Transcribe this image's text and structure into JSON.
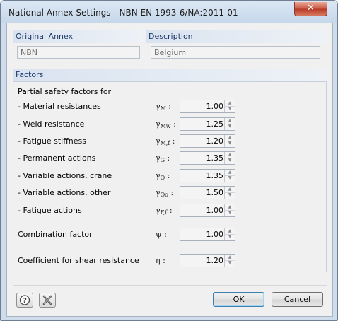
{
  "window": {
    "title": "National Annex Settings - NBN EN 1993-6/NA:2011-01",
    "close_glyph": "✕"
  },
  "original_annex": {
    "title": "Original Annex",
    "value": "NBN"
  },
  "description": {
    "title": "Description",
    "value": "Belgium"
  },
  "factors": {
    "title": "Factors",
    "partial_heading": "Partial safety factors for",
    "rows": [
      {
        "label": "- Material resistances",
        "sym": "γ",
        "sub": "M",
        "value": "1.00"
      },
      {
        "label": "- Weld resistance",
        "sym": "γ",
        "sub": "Mw",
        "value": "1.25"
      },
      {
        "label": "- Fatigue stiffness",
        "sym": "γ",
        "sub": "M,f",
        "value": "1.20"
      },
      {
        "label": "- Permanent actions",
        "sym": "γ",
        "sub": "G",
        "value": "1.35"
      },
      {
        "label": "- Variable actions, crane",
        "sym": "γ",
        "sub": "Q",
        "value": "1.35"
      },
      {
        "label": "- Variable actions, other",
        "sym": "γ",
        "sub": "Qo",
        "value": "1.50"
      },
      {
        "label": "- Fatigue actions",
        "sym": "γ",
        "sub": "F,f",
        "value": "1.00"
      }
    ],
    "combination": {
      "label": "Combination factor",
      "sym": "ψ",
      "value": "1.00"
    },
    "shear": {
      "label": "Coefficient for shear resistance",
      "sym": "η",
      "value": "1.20"
    },
    "colon": ":"
  },
  "buttons": {
    "ok": "OK",
    "cancel": "Cancel",
    "help_icon": "help-icon",
    "reset_icon": "reset-icon"
  }
}
